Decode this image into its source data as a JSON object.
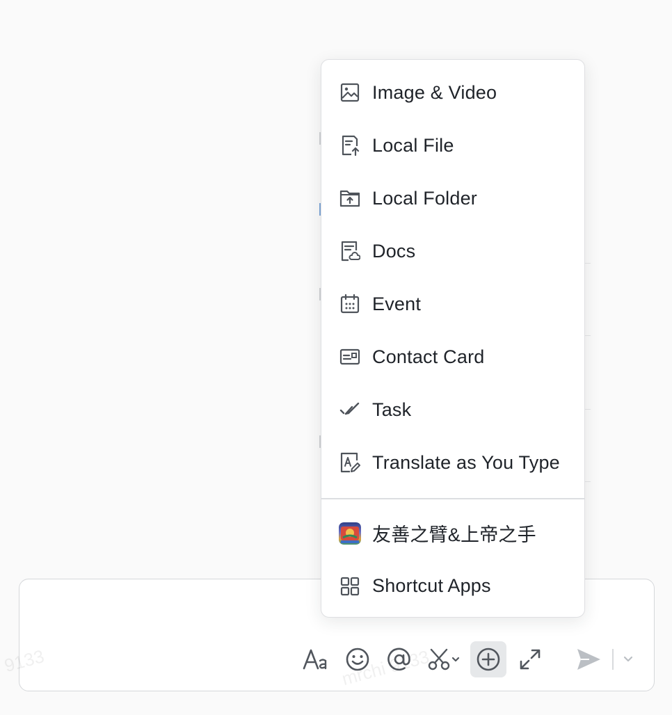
{
  "watermark": {
    "text_full": "mrchi 9133",
    "text_short": "mrchi",
    "text_num": "9133"
  },
  "attach_menu": {
    "items": [
      {
        "label": "Image & Video",
        "icon": "image-icon"
      },
      {
        "label": "Local File",
        "icon": "file-upload-icon"
      },
      {
        "label": "Local Folder",
        "icon": "folder-upload-icon"
      },
      {
        "label": "Docs",
        "icon": "docs-icon"
      },
      {
        "label": "Event",
        "icon": "calendar-icon"
      },
      {
        "label": "Contact Card",
        "icon": "contact-card-icon"
      },
      {
        "label": "Task",
        "icon": "task-check-icon"
      },
      {
        "label": "Translate as You Type",
        "icon": "translate-icon"
      }
    ],
    "apps": [
      {
        "label": "友善之臂&上帝之手",
        "icon": "app-avatar-icon"
      },
      {
        "label": "Shortcut Apps",
        "icon": "grid-apps-icon"
      }
    ]
  },
  "composer": {
    "toolbar": [
      {
        "name": "text-format-button",
        "icon": "text-format-icon"
      },
      {
        "name": "emoji-button",
        "icon": "emoji-icon"
      },
      {
        "name": "mention-button",
        "icon": "at-icon"
      },
      {
        "name": "screenshot-button",
        "icon": "scissors-icon"
      },
      {
        "name": "attach-button",
        "icon": "plus-circle-icon",
        "active": true
      },
      {
        "name": "expand-button",
        "icon": "expand-icon"
      }
    ],
    "send": {
      "icon": "send-icon",
      "options_icon": "chevron-down-icon"
    }
  },
  "colors": {
    "icon": "#4e535a",
    "text": "#1f2329",
    "active_bg": "#e6e8ea",
    "send_disabled": "#bbbfc4"
  }
}
